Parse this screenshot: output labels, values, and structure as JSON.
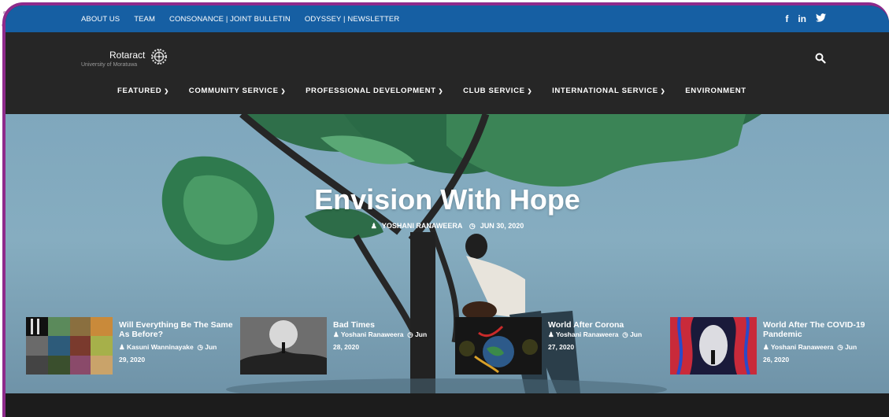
{
  "topbar": {
    "links": [
      "ABOUT US",
      "TEAM",
      "CONSONANCE | JOINT BULLETIN",
      "ODYSSEY | NEWSLETTER"
    ],
    "social": [
      "f",
      "in",
      "𝕏"
    ]
  },
  "logo": {
    "brand": "Rotaract",
    "sub": "University of Moratuwa"
  },
  "menu": [
    {
      "label": "FEATURED",
      "dropdown": true
    },
    {
      "label": "COMMUNITY SERVICE",
      "dropdown": true
    },
    {
      "label": "PROFESSIONAL DEVELOPMENT",
      "dropdown": true
    },
    {
      "label": "CLUB SERVICE",
      "dropdown": true
    },
    {
      "label": "INTERNATIONAL SERVICE",
      "dropdown": true
    },
    {
      "label": "ENVIRONMENT",
      "dropdown": false
    }
  ],
  "hero": {
    "title": "Envision With Hope",
    "author": "YOSHANI RANAWEERA",
    "date": "JUN 30, 2020"
  },
  "posts": [
    {
      "title": "Will Everything Be The Same As Before?",
      "author": "Kasuni Wanninayake",
      "date_a": "Jun",
      "date_b": "29, 2020"
    },
    {
      "title": "Bad Times",
      "author": "Yoshani Ranaweera",
      "date_a": "Jun",
      "date_b": "28, 2020"
    },
    {
      "title": "World After Corona",
      "author": "Yoshani Ranaweera",
      "date_a": "Jun",
      "date_b": "27, 2020"
    },
    {
      "title": "World After The COVID-19 Pandemic",
      "author": "Yoshani Ranaweera",
      "date_a": "Jun",
      "date_b": "26, 2020"
    }
  ],
  "colors": {
    "topbar": "#165fa3",
    "navbar": "#262626",
    "frame": "#8e2a8b"
  }
}
